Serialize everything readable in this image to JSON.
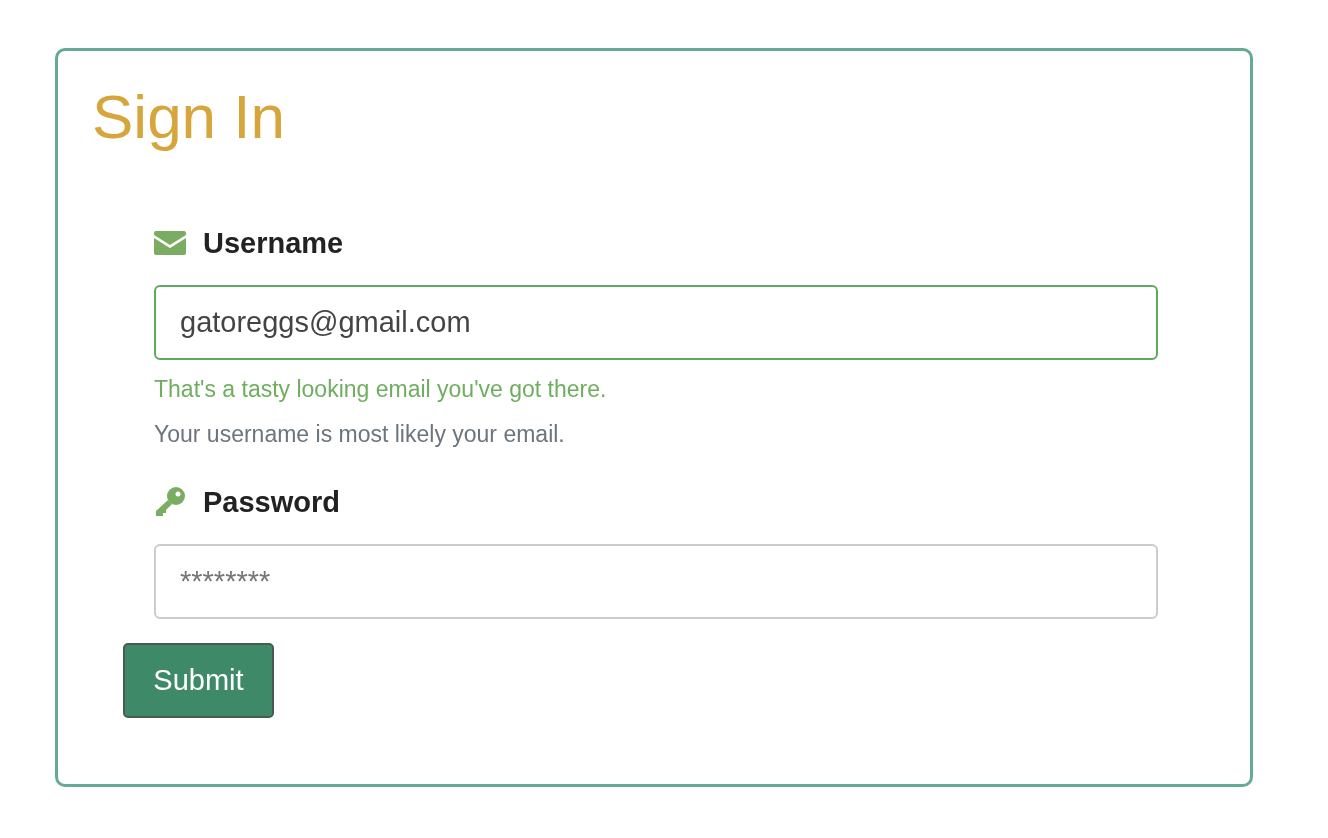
{
  "title": "Sign In",
  "fields": [
    {
      "kind": "email",
      "label": "Username",
      "value": "gatoreggs@gmail.com",
      "valid": true,
      "feedback": "That's a tasty looking email you've got there.",
      "help": "Your username is most likely your email."
    },
    {
      "kind": "password",
      "label": "Password",
      "placeholder": "********",
      "valid": false
    }
  ],
  "submit": {
    "label": "Submit"
  }
}
